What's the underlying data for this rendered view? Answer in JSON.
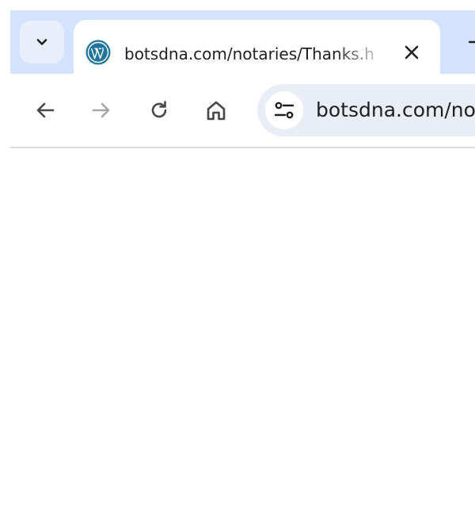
{
  "browser": {
    "tab_search": {
      "icon": "chevron-down-icon"
    },
    "tabs": [
      {
        "title": "botsdna.com/notaries/Thanks.h",
        "favicon": "wordpress-icon",
        "active": true,
        "close_icon": "close-icon"
      }
    ],
    "new_tab": {
      "icon": "plus-icon"
    },
    "toolbar": {
      "back_icon": "arrow-left-icon",
      "forward_icon": "arrow-right-icon",
      "reload_icon": "reload-icon",
      "home_icon": "home-icon",
      "site_info_icon": "tune-icon"
    },
    "omnibox": {
      "url": "botsdna.com/notaries/Thanks.h"
    }
  },
  "colors": {
    "tabstrip_bg": "#d3e3fd",
    "omnibox_bg": "#e9eef6",
    "text": "#1f1f1f",
    "icon": "#474747",
    "disabled_icon": "#a6a6a6",
    "wordpress_blue": "#21759b"
  }
}
